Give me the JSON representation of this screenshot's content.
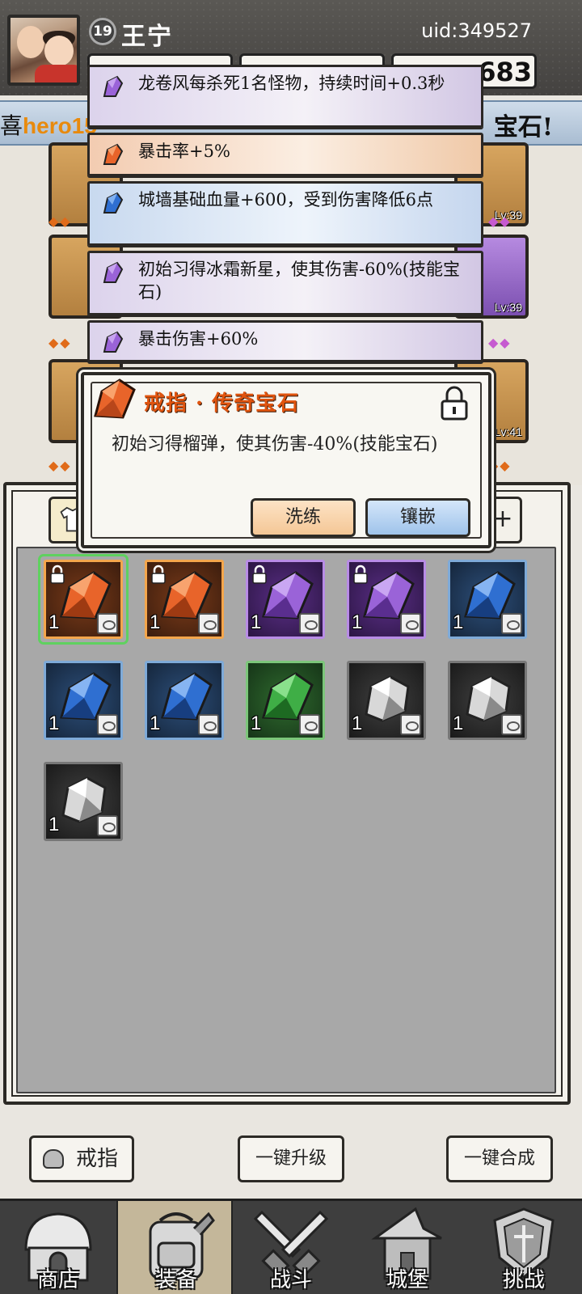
{
  "player": {
    "level": "19",
    "name": "王宁",
    "uid": "uid:349527",
    "currency_value": "683"
  },
  "banner": {
    "left_text_prefix": "喜",
    "left_text_name": "hero15",
    "right_text": "宝石!"
  },
  "equipment_slots": [
    {
      "level": ""
    },
    {
      "level": "Lv:39"
    },
    {
      "level": ""
    },
    {
      "level": "Lv:39"
    },
    {
      "level": ""
    },
    {
      "level": "Lv:41"
    }
  ],
  "affixes": [
    {
      "rarity": "purple",
      "text": "龙卷风每杀死1名怪物，持续时间+0.3秒"
    },
    {
      "rarity": "orange",
      "text": "暴击率+5%"
    },
    {
      "rarity": "blue",
      "text": "城墙基础血量+600，受到伤害降低6点"
    },
    {
      "rarity": "purple",
      "text": "初始习得冰霜新星，使其伤害-60%(技能宝石)"
    },
    {
      "rarity": "purple",
      "text": "暴击伤害+60%"
    }
  ],
  "popup": {
    "title": "戒指 · 传奇宝石",
    "description": "初始习得榴弹，使其伤害-40%(技能宝石)",
    "refine_label": "洗练",
    "inlay_label": "镶嵌",
    "locked": true
  },
  "inventory": {
    "plus_label": "+",
    "items": [
      {
        "rarity": "orange",
        "count": "1",
        "locked": true,
        "selected": true
      },
      {
        "rarity": "orange",
        "count": "1",
        "locked": true,
        "selected": false
      },
      {
        "rarity": "purple",
        "count": "1",
        "locked": true,
        "selected": false
      },
      {
        "rarity": "purple",
        "count": "1",
        "locked": true,
        "selected": false
      },
      {
        "rarity": "blue",
        "count": "1",
        "locked": false,
        "selected": false
      },
      {
        "rarity": "blue",
        "count": "1",
        "locked": false,
        "selected": false
      },
      {
        "rarity": "blue",
        "count": "1",
        "locked": false,
        "selected": false
      },
      {
        "rarity": "green",
        "count": "1",
        "locked": false,
        "selected": false
      },
      {
        "rarity": "white",
        "count": "1",
        "locked": false,
        "selected": false
      },
      {
        "rarity": "white",
        "count": "1",
        "locked": false,
        "selected": false
      },
      {
        "rarity": "white",
        "count": "1",
        "locked": false,
        "selected": false
      }
    ]
  },
  "bottom_buttons": {
    "ring_filter_label": "戒指",
    "upgrade_all_label": "一键升级",
    "merge_all_label": "一键合成"
  },
  "nav": [
    {
      "label": "商店",
      "icon": "shop-hut-icon",
      "active": false
    },
    {
      "label": "装备",
      "icon": "backpack-icon",
      "active": true
    },
    {
      "label": "战斗",
      "icon": "crossed-swords-icon",
      "active": false
    },
    {
      "label": "城堡",
      "icon": "castle-tower-icon",
      "active": false
    },
    {
      "label": "挑战",
      "icon": "shield-crest-icon",
      "active": false
    }
  ],
  "colors": {
    "orange_gem": "#e8642a",
    "purple_gem": "#9a63d8",
    "blue_gem": "#2f6fd1",
    "green_gem": "#3fae46",
    "white_gem": "#d8d8d8",
    "popup_title": "#e0540f",
    "selected_outline": "#5fd15f"
  }
}
